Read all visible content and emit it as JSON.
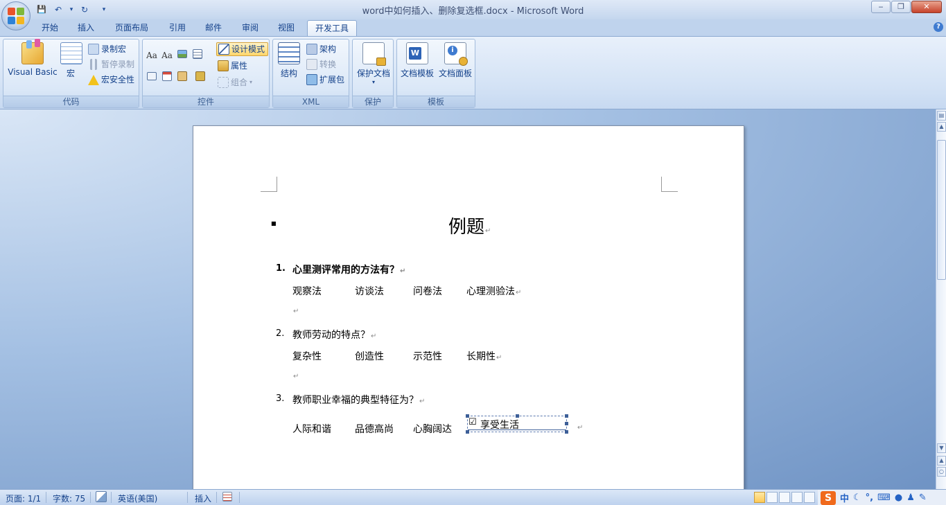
{
  "window": {
    "title": "word中如何插入、删除复选框.docx - Microsoft Word",
    "minimize": "‒",
    "maximize": "❐",
    "close": "✕"
  },
  "qat": {
    "save": "💾",
    "undo": "↶",
    "undo_arrow": "▾",
    "redo": "↻",
    "customize": "▾"
  },
  "tabs": [
    "开始",
    "插入",
    "页面布局",
    "引用",
    "邮件",
    "审阅",
    "视图",
    "开发工具"
  ],
  "help": "?",
  "ribbon": {
    "code": {
      "label": "代码",
      "visual_basic": "Visual Basic",
      "macros": "宏",
      "record_macro": "录制宏",
      "pause_recording": "暂停录制",
      "macro_security": "宏安全性"
    },
    "controls": {
      "label": "控件",
      "rich_text": "Aa",
      "plain_text": "Aa",
      "design_mode": "设计模式",
      "properties": "属性",
      "group": "组合"
    },
    "xml": {
      "label": "XML",
      "structure": "结构",
      "schema": "架构",
      "transform": "转换",
      "expansion_packs": "扩展包"
    },
    "protect": {
      "label": "保护",
      "protect_document": "保护文档"
    },
    "templates": {
      "label": "模板",
      "document_template": "文档模板",
      "document_panel": "文档面板"
    }
  },
  "document": {
    "title": "例题",
    "paragraph_mark": "↵",
    "questions": [
      {
        "number": "1.",
        "text": "心里测评常用的方法有？",
        "options": [
          "观察法",
          "访谈法",
          "问卷法",
          "心理测验法"
        ]
      },
      {
        "number": "2.",
        "text": "教师劳动的特点？",
        "options": [
          "复杂性",
          "创造性",
          "示范性",
          "长期性"
        ]
      },
      {
        "number": "3.",
        "text": "教师职业幸福的典型特征为？",
        "options": [
          "人际和谐",
          "品德高尚",
          "心胸阔达",
          "享受生活"
        ]
      }
    ],
    "checkbox_mark": "☑"
  },
  "statusbar": {
    "page": "页面: 1/1",
    "words": "字数: 75",
    "language": "英语(美国)",
    "mode": "插入"
  },
  "ime": {
    "logo": "S",
    "chinese": "中"
  },
  "colors": {
    "accent": "#15428b",
    "ribbon": "#d3e2f5",
    "design_mode": "#ffd66b"
  }
}
